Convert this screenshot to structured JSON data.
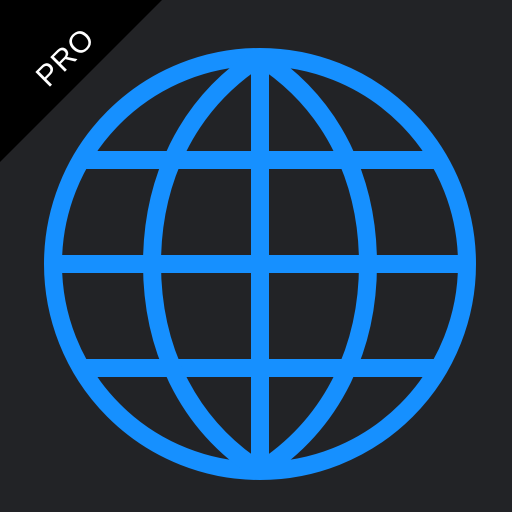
{
  "icon": {
    "badge_label": "PRO",
    "glyph": "globe-icon",
    "colors": {
      "background": "#222326",
      "badge_band": "#000000",
      "badge_text": "#ffffff",
      "globe_stroke": "#1690ff"
    }
  }
}
